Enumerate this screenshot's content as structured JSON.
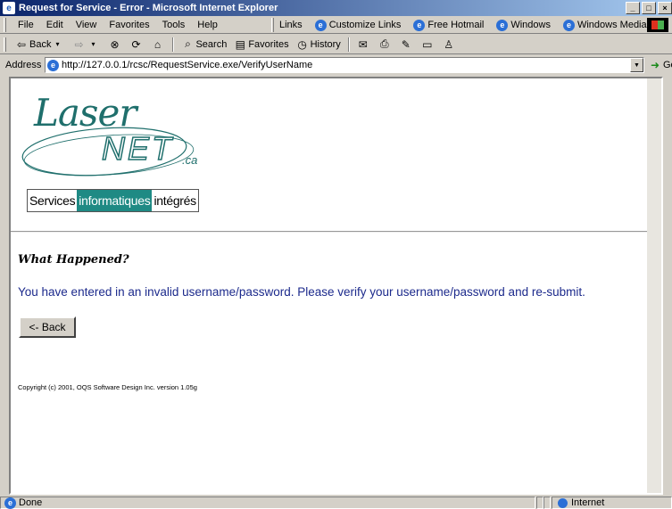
{
  "window": {
    "title": "Request for Service - Error - Microsoft Internet Explorer",
    "controls": [
      "_",
      "□",
      "×"
    ]
  },
  "menubar": {
    "items": [
      "File",
      "Edit",
      "View",
      "Favorites",
      "Tools",
      "Help"
    ],
    "links_label": "Links",
    "links": [
      "Customize Links",
      "Free Hotmail",
      "Windows",
      "Windows Media"
    ]
  },
  "toolbar": {
    "back": "Back",
    "search": "Search",
    "favorites": "Favorites",
    "history": "History"
  },
  "address": {
    "label": "Address",
    "url": "http://127.0.0.1/rcsc/RequestService.exe/VerifyUserName",
    "go": "Go"
  },
  "logo": {
    "word1": "Laser",
    "word2": "NET",
    "suffix": ".ca",
    "tagline_1": "Services",
    "tagline_2": "informatiques",
    "tagline_3": "intégrés"
  },
  "page": {
    "heading": "What Happened?",
    "message": "You have entered in an invalid username/password. Please verify your username/password and re-submit.",
    "back_button": "<- Back",
    "copyright": "Copyright (c) 2001, OQS Software Design Inc. version 1.05g"
  },
  "statusbar": {
    "status": "Done",
    "zone": "Internet"
  },
  "colors": {
    "title_gradient_start": "#0a246a",
    "message_text": "#1c2a8c",
    "logo_teal": "#1f8a84"
  }
}
